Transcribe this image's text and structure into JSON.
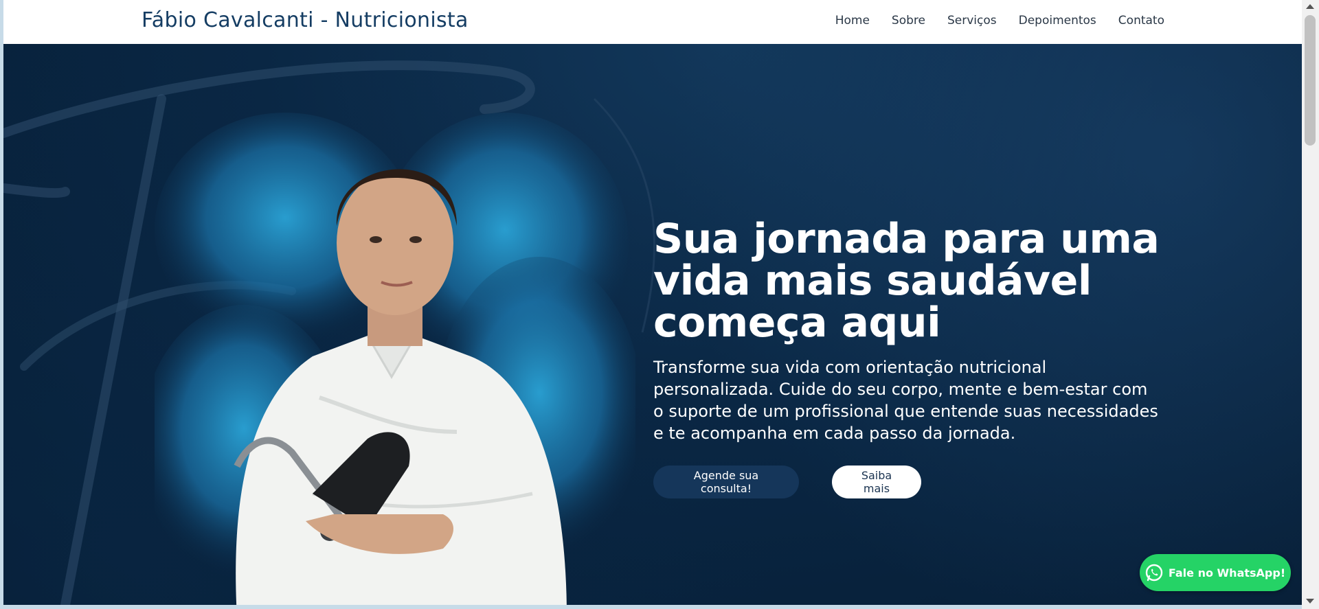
{
  "navbar": {
    "brand": "Fábio Cavalcanti - Nutricionista",
    "links": [
      "Home",
      "Sobre",
      "Serviços",
      "Depoimentos",
      "Contato"
    ]
  },
  "hero": {
    "title": "Sua jornada para uma vida mais saudável começa aqui",
    "subtitle": "Transforme sua vida com orientação nutricional personalizada. Cuide do seu corpo, mente e bem-estar com o suporte de um profissional que entende suas necessidades e te acompanha em cada passo da jornada.",
    "primary_button": "Agende sua consulta!",
    "secondary_button": "Saiba mais",
    "image_icon": "nutritionist-portrait-with-skinfold-caliper"
  },
  "whatsapp": {
    "label": "Fale no WhatsApp!",
    "icon": "whatsapp-icon"
  },
  "colors": {
    "brand": "#153d63",
    "hero_background": "#0a2744",
    "primary_button": "#15365a",
    "whatsapp": "#25d366"
  }
}
